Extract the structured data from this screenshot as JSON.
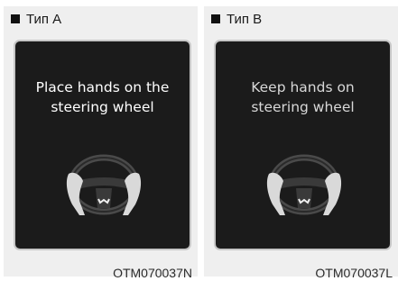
{
  "panel_a": {
    "title": "Тип A",
    "message": "Place hands on the\nsteering wheel",
    "image_code": "OTM070037N"
  },
  "panel_b": {
    "title": "Тип B",
    "message": "Keep hands on\nsteering wheel",
    "image_code": "OTM070037L"
  },
  "icons": [
    "square-bullet-icon",
    "steering-wheel-with-hands-icon"
  ],
  "colors": {
    "screen": "#1b1b1b",
    "panel": "#efefef",
    "text_on_screen": "#ffffff"
  }
}
